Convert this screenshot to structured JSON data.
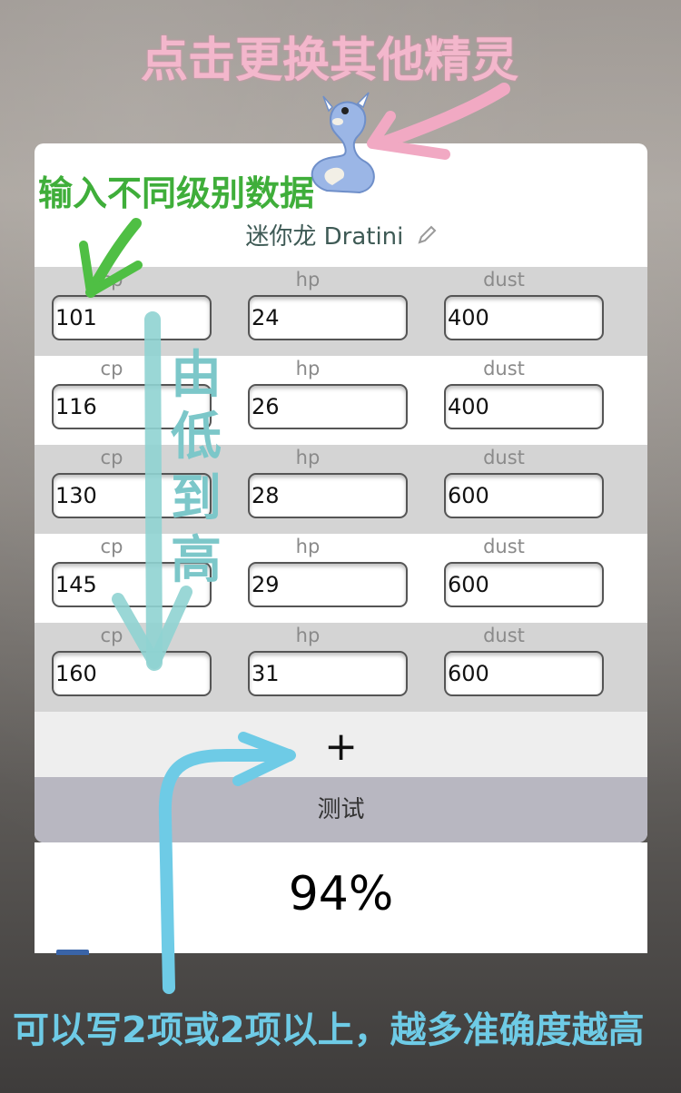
{
  "annotations": {
    "top": "点击更换其他精灵",
    "input_hint": "输入不同级别数据",
    "low_to_high": "由低到高",
    "bottom": "可以写2项或2项以上，越多准确度越高"
  },
  "pokemon": {
    "name": "迷你龙 Dratini"
  },
  "columns": [
    "cp",
    "hp",
    "dust"
  ],
  "rows": [
    {
      "cp": "101",
      "hp": "24",
      "dust": "400"
    },
    {
      "cp": "116",
      "hp": "26",
      "dust": "400"
    },
    {
      "cp": "130",
      "hp": "28",
      "dust": "600"
    },
    {
      "cp": "145",
      "hp": "29",
      "dust": "600"
    },
    {
      "cp": "160",
      "hp": "31",
      "dust": "600"
    }
  ],
  "add_label": "+",
  "test_label": "测试",
  "result": "94%",
  "colors": {
    "pink": "#f3b7cc",
    "green": "#3fae3a",
    "teal": "#7cc7c9",
    "blue": "#6ecbe6",
    "gray_row": "#d4d4d4",
    "test_bg": "#b8b7c1"
  }
}
